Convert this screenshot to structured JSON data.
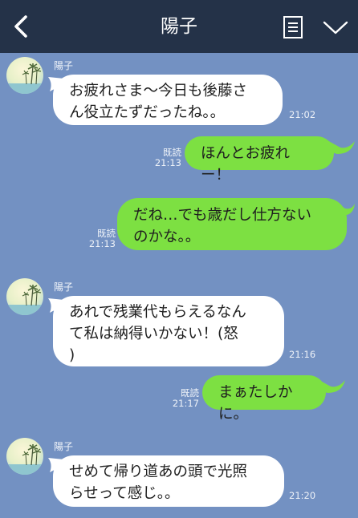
{
  "header": {
    "title": "陽子",
    "back_icon": "chevron-left-icon",
    "menu_icon": "notes-menu-icon",
    "collapse_icon": "chevron-down-icon",
    "background": "#243248"
  },
  "chat": {
    "background": "#7391c2",
    "sent_bubble_color": "#7de042",
    "received_bubble_color": "#ffffff",
    "messages": [
      {
        "direction": "received",
        "sender": "陽子",
        "lines": [
          "お疲れさま〜今日も後藤さ",
          "ん役立たずだったね。。"
        ],
        "time": "21:02"
      },
      {
        "direction": "sent",
        "lines": [
          "ほんとお疲れー！"
        ],
        "read": "既読",
        "time": "21:13"
      },
      {
        "direction": "sent",
        "lines": [
          "だね…でも歳だし仕方ない",
          "のかな。。"
        ],
        "read": "既読",
        "time": "21:13"
      },
      {
        "direction": "received",
        "sender": "陽子",
        "lines": [
          "あれで残業代もらえるなん",
          "て私は納得いかない！(怒",
          ")"
        ],
        "time": "21:16"
      },
      {
        "direction": "sent",
        "lines": [
          "まぁたしかに。"
        ],
        "read": "既読",
        "time": "21:17"
      },
      {
        "direction": "received",
        "sender": "陽子",
        "lines": [
          "せめて帰り道あの頭で光照",
          "らせって感じ。。"
        ],
        "time": "21:20"
      }
    ]
  }
}
